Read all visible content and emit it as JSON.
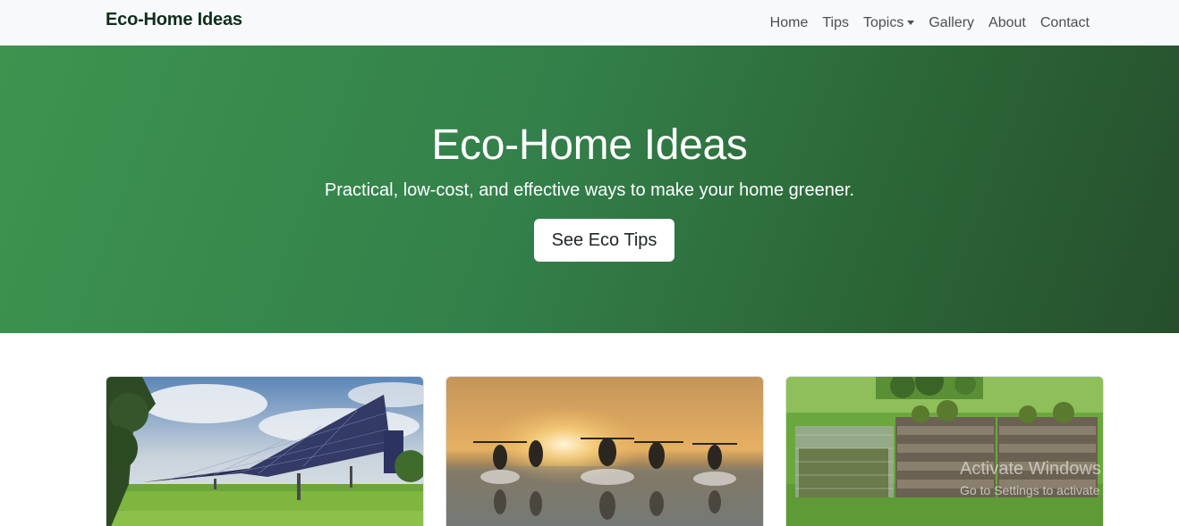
{
  "navbar": {
    "brand": "Eco-Home Ideas",
    "links": [
      {
        "label": "Home"
      },
      {
        "label": "Tips"
      },
      {
        "label": "Topics"
      },
      {
        "label": "Gallery"
      },
      {
        "label": "About"
      },
      {
        "label": "Contact"
      }
    ]
  },
  "hero": {
    "title": "Eco-Home Ideas",
    "subtitle": "Practical, low-cost, and effective ways to make your home greener.",
    "button_label": "See Eco Tips",
    "gradient_start": "#3d944f",
    "gradient_end": "#264f2c"
  },
  "cards": [
    {
      "image": "solar-panels-field"
    },
    {
      "image": "salt-field-workers-sunset"
    },
    {
      "image": "compost-bins-garden"
    }
  ],
  "watermark": {
    "title": "Activate Windows",
    "subtitle": "Go to Settings to activate Windows."
  }
}
